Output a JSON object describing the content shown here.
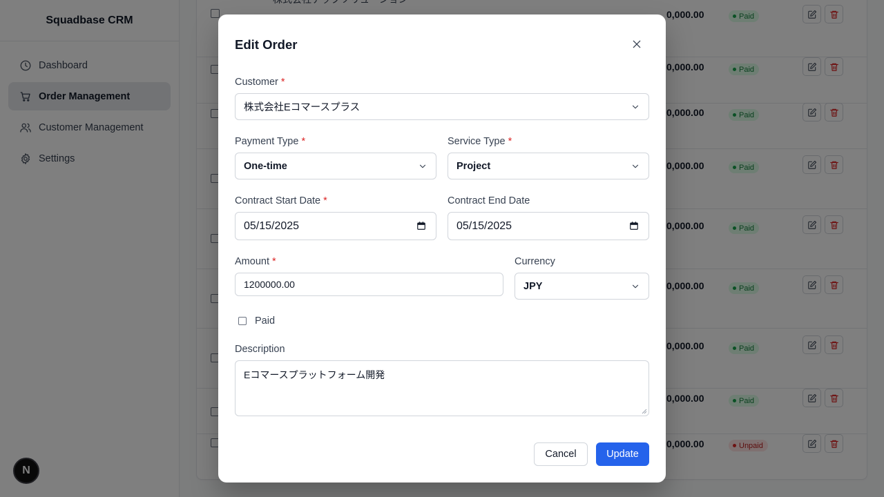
{
  "app": {
    "title": "Squadbase CRM"
  },
  "sidebar": {
    "items": [
      {
        "label": "Dashboard",
        "icon": "clock-icon",
        "active": false
      },
      {
        "label": "Order Management",
        "icon": "cart-icon",
        "active": true
      },
      {
        "label": "Customer Management",
        "icon": "users-icon",
        "active": false
      },
      {
        "label": "Settings",
        "icon": "gear-icon",
        "active": false
      }
    ]
  },
  "next_badge": "N",
  "table": {
    "top_customer": "株式会社テックソリューション",
    "rows": [
      {
        "amount": "0,000.00",
        "status": "Paid"
      },
      {
        "amount": "0,000.00",
        "status": "Paid"
      },
      {
        "amount": "0,000.00",
        "status": "Paid"
      },
      {
        "amount": "0,000.00",
        "status": "Paid"
      },
      {
        "amount": "0,000.00",
        "status": "Paid"
      },
      {
        "amount": "0,000.00",
        "status": "Paid"
      },
      {
        "amount": "0,000.00",
        "status": "Paid"
      },
      {
        "amount": "0,000.00",
        "status": "Paid"
      },
      {
        "amount": "0,000.00",
        "status": "Unpaid"
      }
    ]
  },
  "modal": {
    "title": "Edit Order",
    "customer": {
      "label": "Customer",
      "required": "*",
      "value": "株式会社Eコマースプラス"
    },
    "payment_type": {
      "label": "Payment Type",
      "required": "*",
      "value": "One-time"
    },
    "service_type": {
      "label": "Service Type",
      "required": "*",
      "value": "Project"
    },
    "contract_start": {
      "label": "Contract Start Date",
      "required": "*",
      "value": "05/15/2025"
    },
    "contract_end": {
      "label": "Contract End Date",
      "value": "05/15/2025"
    },
    "amount": {
      "label": "Amount",
      "required": "*",
      "value": "1200000.00"
    },
    "currency": {
      "label": "Currency",
      "value": "JPY"
    },
    "paid": {
      "label": "Paid",
      "checked": false
    },
    "description": {
      "label": "Description",
      "value": "Eコマースプラットフォーム開発"
    },
    "cancel_label": "Cancel",
    "update_label": "Update"
  },
  "colors": {
    "primary": "#2563eb",
    "required": "#dc2626",
    "paid": "#15803d",
    "unpaid": "#b91c1c"
  }
}
